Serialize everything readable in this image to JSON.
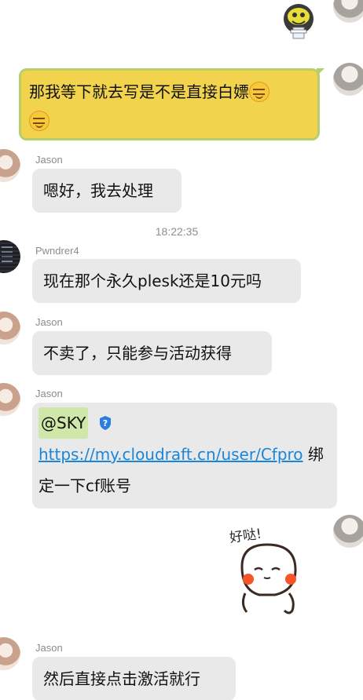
{
  "messages": {
    "self_text": {
      "text": "那我等下就去写是不是直接白嫖"
    },
    "jason_1": {
      "sender": "Jason",
      "text": "嗯好，我去处理"
    },
    "timestamp": "18:22:35",
    "pwndrer": {
      "sender": "Pwndrer4",
      "text": "现在那个永久plesk还是10元吗"
    },
    "jason_2": {
      "sender": "Jason",
      "text": "不卖了，只能参与活动获得"
    },
    "jason_3": {
      "sender": "Jason",
      "mention": "@SKY",
      "link": "https://my.cloudraft.cn/user/Cfpro",
      "text": " 绑定一下cf账号"
    },
    "sticker": {
      "caption": "好哒!"
    },
    "jason_4": {
      "sender": "Jason",
      "text": "然后直接点击激活就行"
    }
  },
  "colors": {
    "self_bubble": "#f2d34e",
    "self_border": "#b6cf6c",
    "other_bubble": "#e9e9e9",
    "link": "#1a86d9",
    "mention_bg": "#cfe7a8"
  }
}
